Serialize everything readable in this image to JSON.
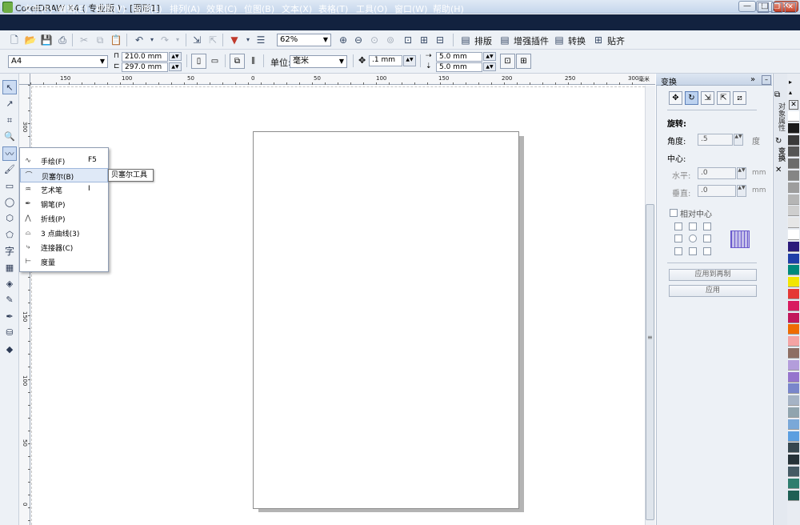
{
  "window": {
    "title": "CorelDRAW X4 ( 专业版 ) - [图形1]",
    "min_label": "—",
    "max_label": "□",
    "close_label": "✕"
  },
  "menu": [
    "文件(F)",
    "编辑(E)",
    "视图(V)",
    "版面(L)",
    "排列(A)",
    "效果(C)",
    "位图(B)",
    "文本(X)",
    "表格(T)",
    "工具(O)",
    "窗口(W)",
    "帮助(H)"
  ],
  "toolbar": {
    "zoom": "62%",
    "layout_label": "排版",
    "plugin_label": "增强插件",
    "convert_label": "转换",
    "snap_label": "贴齐"
  },
  "propbar": {
    "paper_size": "A4",
    "width": "210.0 mm",
    "height": "297.0 mm",
    "unit_label": "单位:",
    "unit_value": "毫米",
    "nudge": ".1 mm",
    "dup_x": "5.0 mm",
    "dup_y": "5.0 mm"
  },
  "ruler": {
    "h_labels": [
      "150",
      "100",
      "50",
      "0",
      "50",
      "100",
      "150",
      "200",
      "250",
      "300"
    ],
    "h_unit": "毫米",
    "v_labels": [
      "300",
      "250",
      "200",
      "150",
      "100",
      "50",
      "0"
    ]
  },
  "flyout": {
    "items": [
      {
        "label": "手绘(F)",
        "key": "F5",
        "icon": "freehand-icon"
      },
      {
        "label": "贝塞尔(B)",
        "key": "",
        "icon": "bezier-icon"
      },
      {
        "label": "艺术笔",
        "key": "I",
        "icon": "artistic-media-icon"
      },
      {
        "label": "钢笔(P)",
        "key": "",
        "icon": "pen-icon"
      },
      {
        "label": "折线(P)",
        "key": "",
        "icon": "polyline-icon"
      },
      {
        "label": "3 点曲线(3)",
        "key": "",
        "icon": "three-point-curve-icon"
      },
      {
        "label": "连接器(C)",
        "key": "",
        "icon": "connector-icon"
      },
      {
        "label": "度量",
        "key": "",
        "icon": "dimension-icon"
      }
    ],
    "tooltip": "贝塞尔工具"
  },
  "docker": {
    "title": "变换",
    "section_rotate": "旋转:",
    "angle_label": "角度:",
    "angle_value": ".5",
    "angle_unit": "度",
    "center_label": "中心:",
    "h_label": "水平:",
    "h_value": ".0",
    "h_unit": "mm",
    "v_label": "垂直:",
    "v_value": ".0",
    "v_unit": "mm",
    "relative_center": "相对中心",
    "apply_dup": "应用到再制",
    "apply": "应用"
  },
  "side_tabs": [
    "对象属性",
    "变换"
  ],
  "palette": [
    "#ffffff",
    "#1a1a1a",
    "#3a3a3a",
    "#555555",
    "#6c6c6c",
    "#858585",
    "#9d9d9d",
    "#b5b5b5",
    "#cecece",
    "#e6e6e6",
    "#ffffff",
    "#2a1a7a",
    "#1f3fa8",
    "#00897b",
    "#f2e500",
    "#e53935",
    "#d81b60",
    "#c2185b",
    "#ef6c00",
    "#f4a3a3",
    "#8d6e63",
    "#b39ddb",
    "#9575cd",
    "#7986cb",
    "#a5b3c5",
    "#90a4ae",
    "#7aa8d8",
    "#5c9fe0",
    "#37474f",
    "#263238",
    "#455a64",
    "#2e7d6e",
    "#1e5f54"
  ]
}
